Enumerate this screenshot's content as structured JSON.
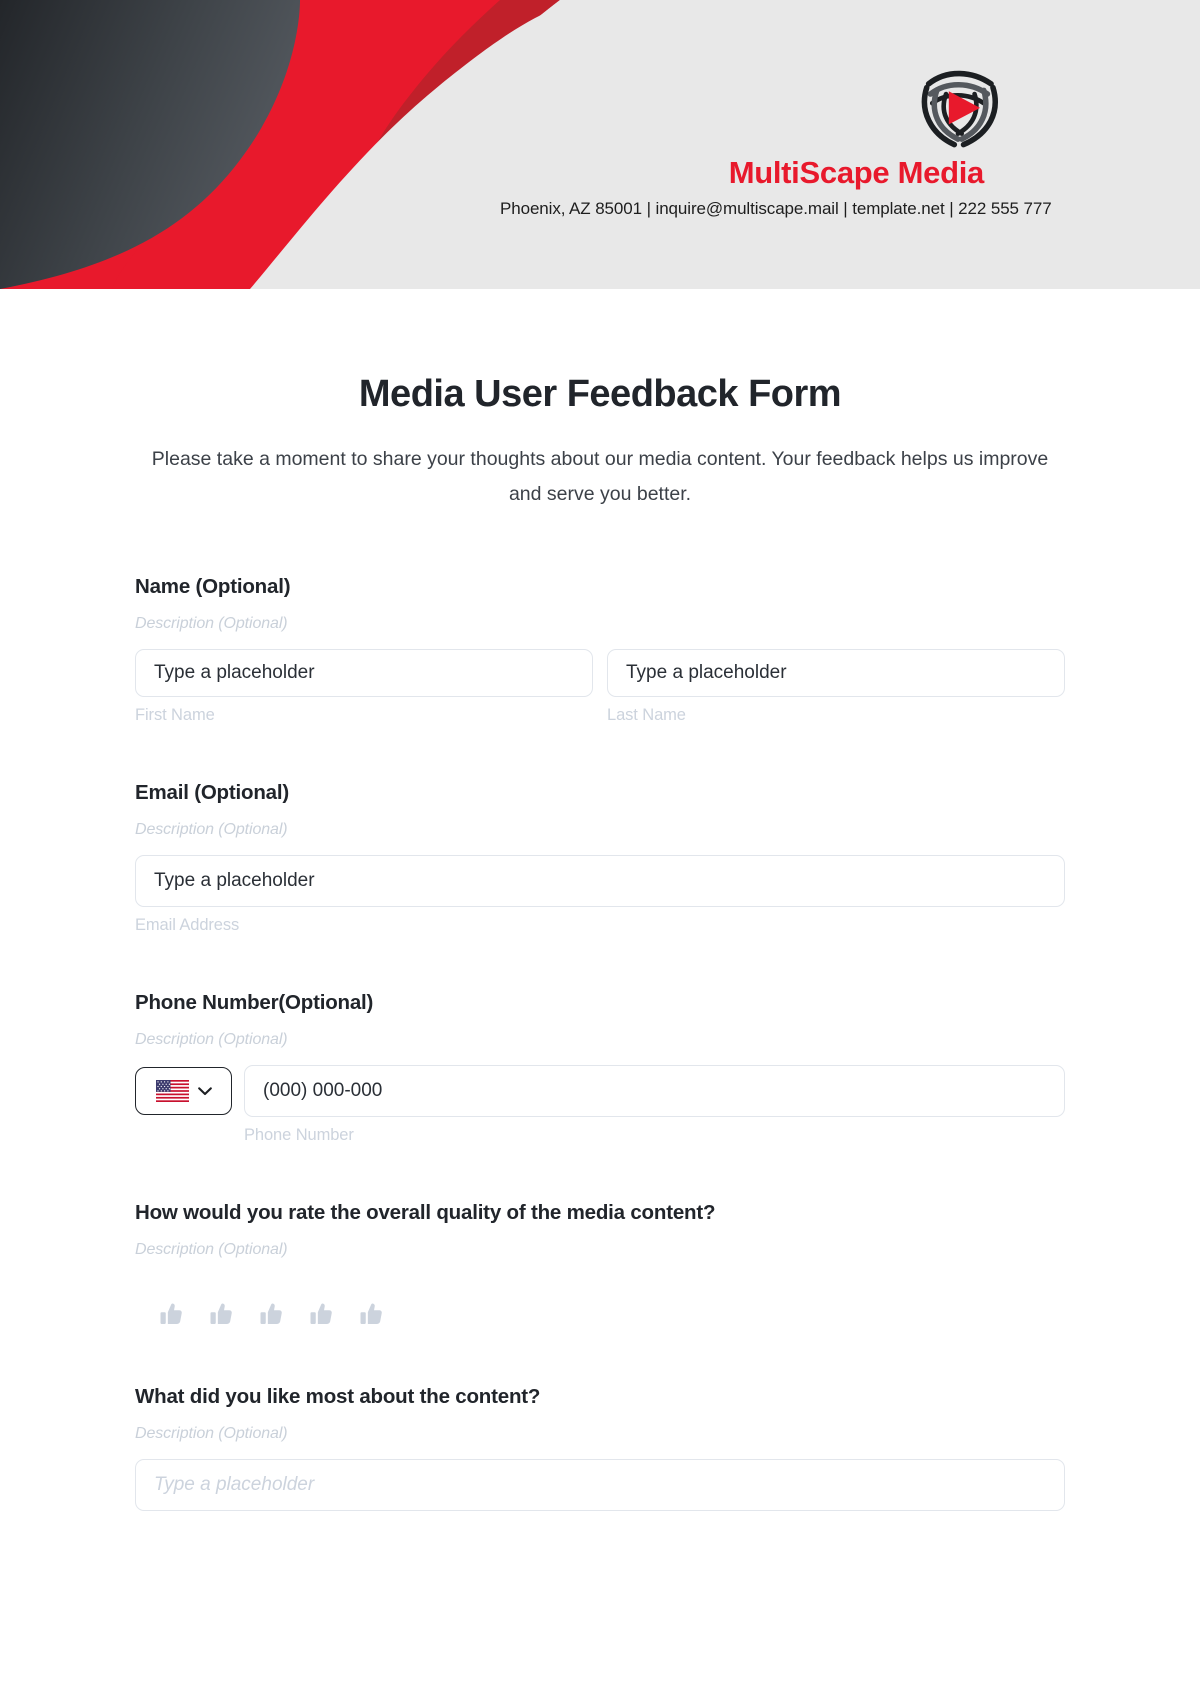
{
  "header": {
    "brand_name": "MultiScape Media",
    "contact_line": "Phoenix, AZ 85001 | inquire@multiscape.mail | template.net | 222 555 777",
    "logo_icon": "media-play-shield-logo",
    "brand_color": "#e8192c",
    "dark_color": "#2e3237",
    "banner_bg": "#e8e8e8"
  },
  "form": {
    "title": "Media User Feedback Form",
    "intro": "Please take a moment to share your thoughts about our media content. Your feedback helps us improve and serve you better.",
    "description_placeholder": "Description (Optional)",
    "fields": [
      {
        "id": "name",
        "label": "Name (Optional)",
        "description": "Description (Optional)",
        "inputs": [
          {
            "placeholder": "Type a placeholder",
            "value": "",
            "sub_label": "First Name"
          },
          {
            "placeholder": "Type a placeholder",
            "value": "",
            "sub_label": "Last Name"
          }
        ]
      },
      {
        "id": "email",
        "label": "Email (Optional)",
        "description": "Description (Optional)",
        "inputs": [
          {
            "placeholder": "Type a placeholder",
            "value": "",
            "sub_label": "Email Address"
          }
        ]
      },
      {
        "id": "phone",
        "label": "Phone Number(Optional)",
        "description": "Description (Optional)",
        "country_flag": "us-flag-icon",
        "dropdown_icon": "chevron-down-icon",
        "inputs": [
          {
            "placeholder": "(000) 000-000",
            "value": "",
            "sub_label": "Phone Number"
          }
        ]
      },
      {
        "id": "rating",
        "label": "How would you rate the overall quality of the media content?",
        "description": "Description (Optional)",
        "rating": {
          "icon": "thumbs-up-icon",
          "count": 5,
          "selected": 0,
          "inactive_color": "#ccd3dd"
        }
      },
      {
        "id": "liked-most",
        "label": "What did you like most about the content?",
        "description": "Description (Optional)",
        "inputs": [
          {
            "placeholder": "Type a placeholder",
            "value": "",
            "sub_label": ""
          }
        ]
      }
    ]
  }
}
